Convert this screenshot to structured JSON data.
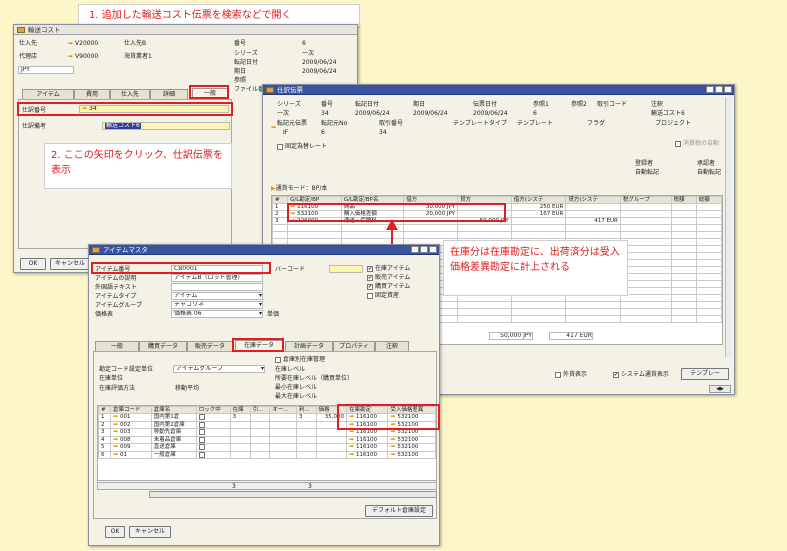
{
  "callouts": {
    "top": "1. 追加した輸送コスト伝票を検索などで開く",
    "arrow_instruction": "2. ここの矢印をクリック、仕訳伝票を表示",
    "inventory_note": "在庫分は在庫勘定に、出荷済分は受入価格差異勘定に計上される"
  },
  "landed_cost": {
    "title": "輸送コスト",
    "vendor_label": "仕入先",
    "vendor_code": "V20000",
    "vendor_name": "仕入先B",
    "agent_label": "代理店",
    "agent_code": "V90000",
    "agent_name": "海貨業者1",
    "currency": "JPY",
    "number_label": "番号",
    "number_value": "6",
    "series_label": "シリーズ",
    "series_value": "一次",
    "posting_label": "転記日付",
    "posting_value": "2009/06/24",
    "due_label": "期日",
    "due_value": "2009/06/24",
    "ref_label": "参照",
    "file_label": "ファイル番号",
    "tabs": [
      "アイテム",
      "費用",
      "仕入先",
      "詳細",
      "一般"
    ],
    "journal_label": "仕訳番号",
    "journal_value": "34",
    "remarks_label": "仕訳備考",
    "remarks_value": "輸送コスト6",
    "ok": "OK",
    "cancel": "キャンセル"
  },
  "journal": {
    "title": "仕訳伝票",
    "head_cols": [
      "シリーズ",
      "番号",
      "転記日付",
      "期日",
      "伝票日付",
      "参照1",
      "参照2",
      "取引コード",
      "注釈"
    ],
    "head_vals": [
      "一次",
      "34",
      "2009/06/24",
      "2009/06/24",
      "2009/06/24",
      "6",
      "",
      "",
      "輸送コスト6"
    ],
    "sub_cols": [
      "転記元伝票",
      "転記元No",
      "取引番号",
      "テンプレートタイプ",
      "テンプレート",
      "フラグ",
      "プロジェクト"
    ],
    "sub_vals": [
      "IF",
      "6",
      "34",
      "",
      "",
      "",
      ""
    ],
    "fixed_rate": "固定為替レート",
    "auto_tax": "消費税の自動",
    "register_label": "登録者",
    "register_value": "自動転記",
    "approver_label": "承認者",
    "approver_value": "自動転記",
    "mode_label": "通貨モード：BP/本",
    "grid_cols": [
      "#",
      "G/L勘定/BP",
      "G/L勘定/BP名",
      "借方",
      "貸方",
      "借方(システ",
      "貸方(システ",
      "税グループ",
      "税額",
      "総額"
    ],
    "rows": [
      [
        "1",
        "116100",
        "商品",
        "30,000 JPY",
        "",
        "250 EUR",
        "",
        "",
        "",
        ""
      ],
      [
        "2",
        "532100",
        "購入価格差額",
        "20,000 JPY",
        "",
        "167 EUR",
        "",
        "",
        "",
        ""
      ],
      [
        "3",
        "226000",
        "運送・保険料",
        "",
        "50,000 JPY",
        "",
        "417 EUR",
        "",
        "",
        ""
      ]
    ],
    "total_debit": "50,000 JPY",
    "total_credit": "50,000 JPY",
    "total_sys_debit": "417 EUR",
    "total_sys_credit": "417 EUR",
    "fc_display": "外貨表示",
    "sys_display": "システム通貨表示",
    "template_btn": "テンプレー"
  },
  "item_master": {
    "title": "アイテムマスタ",
    "item_no_label": "アイテム番号",
    "item_no_value": "CB0001",
    "desc_label": "アイテムの説明",
    "desc_value": "アイテムB（ロット管理）",
    "foreign_label": "外国語テキスト",
    "type_label": "アイテムタイプ",
    "type_value": "アイテム",
    "group_label": "アイテムグループ",
    "group_value": "チャコリネ",
    "price_label": "価格表",
    "price_value": "価格表 06",
    "unit_price_label": "単価",
    "barcode_label": "バーコード",
    "checks": [
      "在庫アイテム",
      "販売アイテム",
      "購買アイテム",
      "固定資産"
    ],
    "tabs": [
      "一般",
      "購買データ",
      "販売データ",
      "在庫データ",
      "計画データ",
      "プロパティ",
      "注釈"
    ],
    "manage_by_wh": "倉庫別在庫管理",
    "gl_label": "勘定コード設定単位",
    "gl_value": "アイテムグループ",
    "uom_label": "在庫単位",
    "valuation_label": "在庫評価方法",
    "valuation_value": "移動平均",
    "level_label": "在庫レベル",
    "req_label": "所要在庫レベル（購買単位）",
    "min_label": "最小在庫レベル",
    "max_label": "最大在庫レベル",
    "grid_cols": [
      "#",
      "倉庫コード",
      "倉庫名",
      "ロック中",
      "在庫",
      "引...",
      "オー...",
      "利...",
      "価格",
      "在庫勘定",
      "受入価格差異"
    ],
    "rows": [
      [
        "1",
        "001",
        "国内第1倉",
        "",
        "3",
        "",
        "",
        "3",
        "35,000",
        "116100",
        "532100"
      ],
      [
        "2",
        "002",
        "国内第2倉庫",
        "",
        "",
        "",
        "",
        "",
        "",
        "116100",
        "532100"
      ],
      [
        "3",
        "003",
        "移動先倉庫",
        "",
        "",
        "",
        "",
        "",
        "",
        "116100",
        "532100"
      ],
      [
        "4",
        "008",
        "未着品倉庫",
        "",
        "",
        "",
        "",
        "",
        "",
        "116100",
        "532100"
      ],
      [
        "5",
        "009",
        "直送倉庫",
        "",
        "",
        "",
        "",
        "",
        "",
        "116100",
        "532100"
      ],
      [
        "6",
        "01",
        "一般倉庫",
        "",
        "",
        "",
        "",
        "",
        "",
        "116100",
        "532100"
      ]
    ],
    "total_stock": "3",
    "total_avail": "3",
    "default_wh_btn": "デフォルト倉庫設定",
    "ok": "OK",
    "cancel": "キャンセル"
  }
}
